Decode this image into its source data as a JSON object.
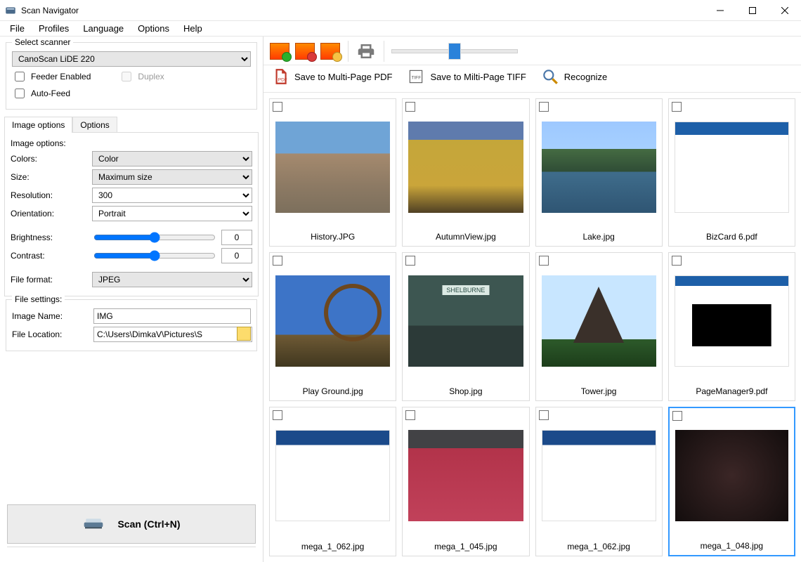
{
  "window": {
    "title": "Scan Navigator"
  },
  "menu": {
    "items": [
      "File",
      "Profiles",
      "Language",
      "Options",
      "Help"
    ]
  },
  "scanner": {
    "group_label": "Select scanner",
    "selected": "CanoScan LiDE 220",
    "feeder_label": "Feeder Enabled",
    "duplex_label": "Duplex",
    "autofeed_label": "Auto-Feed"
  },
  "settings_tabs": {
    "image_options": "Image options",
    "options": "Options"
  },
  "image_options": {
    "group_label": "Image options:",
    "colors_label": "Colors:",
    "colors_value": "Color",
    "size_label": "Size:",
    "size_value": "Maximum size",
    "resolution_label": "Resolution:",
    "resolution_value": "300",
    "orientation_label": "Orientation:",
    "orientation_value": "Portrait",
    "brightness_label": "Brightness:",
    "brightness_value": "0",
    "contrast_label": "Contrast:",
    "contrast_value": "0",
    "file_format_label": "File format:",
    "file_format_value": "JPEG"
  },
  "file_settings": {
    "group_label": "File settings:",
    "image_name_label": "Image Name:",
    "image_name_value": "IMG",
    "file_location_label": "File Location:",
    "file_location_value": "C:\\Users\\DimkaV\\Pictures\\S"
  },
  "scan_button": "Scan (Ctrl+N)",
  "actions": {
    "save_pdf": "Save to Multi-Page PDF",
    "save_tiff": "Save to Milti-Page TIFF",
    "recognize": "Recognize"
  },
  "thumbnails": [
    {
      "name": "History.JPG"
    },
    {
      "name": "AutumnView.jpg"
    },
    {
      "name": "Lake.jpg"
    },
    {
      "name": "BizCard 6.pdf"
    },
    {
      "name": "Play Ground.jpg"
    },
    {
      "name": "Shop.jpg"
    },
    {
      "name": "Tower.jpg"
    },
    {
      "name": "PageManager9.pdf"
    },
    {
      "name": "mega_1_062.jpg"
    },
    {
      "name": "mega_1_045.jpg"
    },
    {
      "name": "mega_1_062.jpg"
    },
    {
      "name": "mega_1_048.jpg"
    }
  ],
  "selected_thumbnail_index": 11,
  "thumb_classes": [
    "fake-colosseum",
    "fake-autumn",
    "fake-lake",
    "fake-doc1",
    "fake-ferris",
    "fake-shop",
    "fake-tower",
    "fake-doc2",
    "fake-web1",
    "fake-web2",
    "fake-web3",
    "fake-dark"
  ]
}
